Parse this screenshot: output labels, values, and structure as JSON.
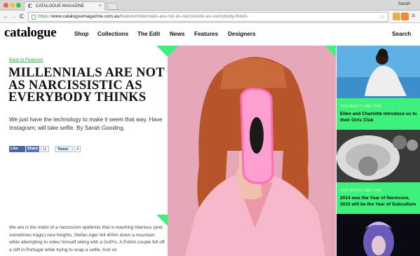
{
  "browser": {
    "tab_title": "CATALOGUE MAGAZINE",
    "tab_favicon": "C",
    "tab_close": "×",
    "user_name": "Sarah",
    "url_scheme": "https://",
    "url_domain": "www.cataloguemagazine.com.au",
    "url_path": "/feature/millennials-are-not-as-narcissistic-as-everybody-thinks",
    "icons": {
      "back": "back-arrow-icon",
      "forward": "forward-arrow-icon",
      "reload": "reload-icon",
      "bookmark": "star-icon",
      "menu": "menu-icon"
    },
    "back_glyph": "←",
    "forward_glyph": "→",
    "reload_glyph": "C",
    "star_glyph": "☆",
    "menu_glyph": "≡"
  },
  "site": {
    "logo": "catalogue",
    "nav": [
      "Shop",
      "Collections",
      "The Edit",
      "News",
      "Features",
      "Designers"
    ],
    "search_label": "Search",
    "accent_color": "#3ef07c"
  },
  "article": {
    "breadcrumb": "Back to Features",
    "headline": "MILLENNIALS ARE NOT AS NARCISSISTIC AS EVERYBODY THINKS",
    "standfirst": "We just have the technology to make it seem that way. Have Instagram; will take selfie. By Sarah Gooding.",
    "share": {
      "fb_like": "Like",
      "fb_share": "Share",
      "fb_count": "11",
      "tweet": "Tweet",
      "tweet_count": "4"
    },
    "body": "We are in the midst of a narcissism epidemic that is reaching hilarious (and sometimes tragic) new heights. Stefan Ager fell 400m down a mountain while attempting to video himself skiing with a GoPro. A Polish couple fell off a cliff in Portugal while trying to snap a selfie. And so"
  },
  "rail": {
    "kicker": "YOU MIGHT LIKE THIS",
    "items": [
      {
        "title": "Ellen and Charlotte Introduce us to their Girls Club"
      },
      {
        "title": "2014 was the Year of Normcore, 2015 will be the Year of Subculture"
      }
    ]
  }
}
